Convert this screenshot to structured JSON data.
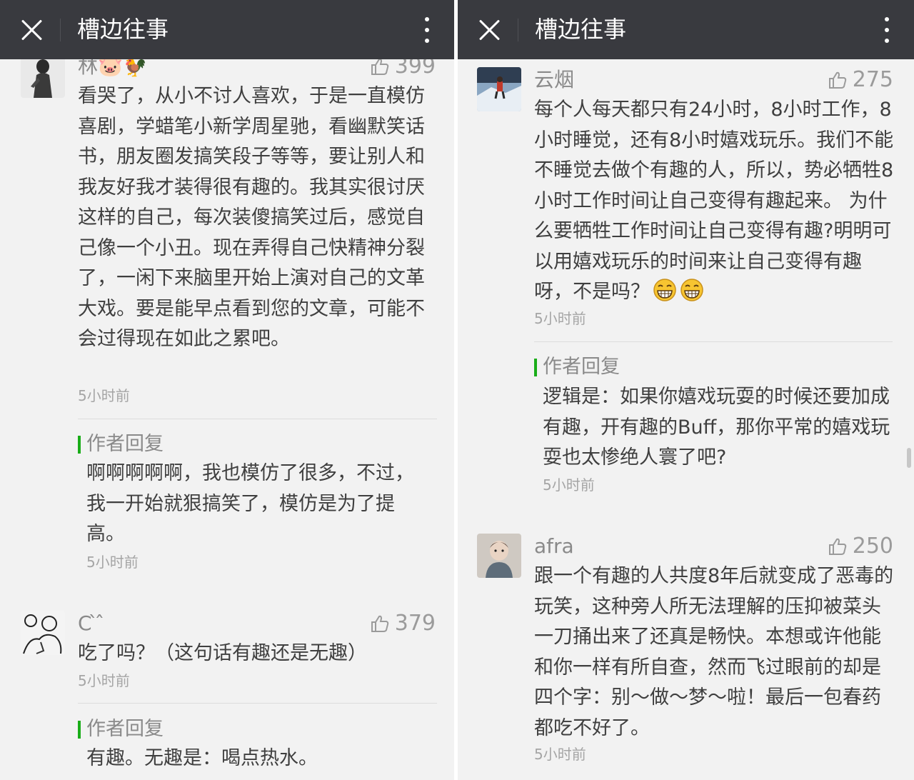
{
  "left": {
    "title": "槽边往事",
    "comments": [
      {
        "nickname": "林🐷🐓",
        "likes": "399",
        "text": "看哭了，从小不讨人喜欢，于是一直模仿喜剧，学蜡笔小新学周星驰，看幽默笑话书，朋友圈发搞笑段子等等，要让别人和我友好我才装得很有趣的。我其实很讨厌这样的自己，每次装傻搞笑过后，感觉自己像一个小丑。现在弄得自己快精神分裂了，一闲下来脑里开始上演对自己的文革大戏。要是能早点看到您的文章，可能不会过得现在如此之累吧。",
        "time": "5小时前",
        "reply": {
          "label": "作者回复",
          "text": "啊啊啊啊啊，我也模仿了很多，不过，我一开始就狠搞笑了，模仿是为了提高。",
          "time": "5小时前"
        }
      },
      {
        "nickname": "C ̀ ̂",
        "likes": "379",
        "text": "吃了吗？（这句话有趣还是无趣）",
        "time": "5小时前",
        "reply": {
          "label": "作者回复",
          "text": "有趣。无趣是：喝点热水。"
        }
      }
    ]
  },
  "right": {
    "title": "槽边往事",
    "comments": [
      {
        "nickname": "云烟",
        "likes": "275",
        "text": "每个人每天都只有24小时，8小时工作，8小时睡觉，还有8小时嬉戏玩乐。我们不能不睡觉去做个有趣的人，所以，势必牺牲8小时工作时间让自己变得有趣起来。 为什么要牺牲工作时间让自己变得有趣?明明可以用嬉戏玩乐的时间来让自己变得有趣呀，不是吗？",
        "emoji": "grin-emoji",
        "time": "5小时前",
        "reply": {
          "label": "作者回复",
          "text": "逻辑是：如果你嬉戏玩耍的时候还要加成有趣，开有趣的Buff，那你平常的嬉戏玩耍也太惨绝人寰了吧?",
          "time": "5小时前"
        }
      },
      {
        "nickname": "afra",
        "likes": "250",
        "text": "跟一个有趣的人共度8年后就变成了恶毒的玩笑，这种旁人所无法理解的压抑被菜头一刀捅出来了还真是畅快。本想或许他能和你一样有所自查，然而飞过眼前的却是四个字：别～做～梦～啦！最后一包春药都吃不好了。",
        "time": "5小时前"
      }
    ]
  },
  "colors": {
    "titlebar": "#393a3f",
    "reply_accent": "#1aad19",
    "background": "#f2f2f2"
  },
  "icons": {
    "close": "close-icon",
    "more": "more-vertical-icon",
    "like": "thumbs-up-icon"
  }
}
